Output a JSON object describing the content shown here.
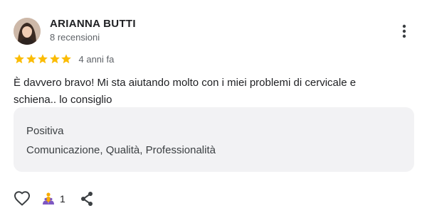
{
  "review": {
    "author_name": "ARIANNA BUTTI",
    "review_count": "8 recensioni",
    "rating": 5,
    "rating_max": 5,
    "relative_date": "4 anni fa",
    "text_line1": "È davvero bravo! Mi sta aiutando molto con i miei problemi di cervicale e",
    "text_line2": "schiena.. lo consiglio",
    "star_color": "#fbbc04"
  },
  "highlights": {
    "title": "Positiva",
    "value": "Comunicazione, Qualità, Professionalità"
  },
  "actions": {
    "reaction_count": "1",
    "icons": [
      "heart-icon",
      "celebrate-icon",
      "share-icon",
      "more-vert-icon"
    ]
  }
}
